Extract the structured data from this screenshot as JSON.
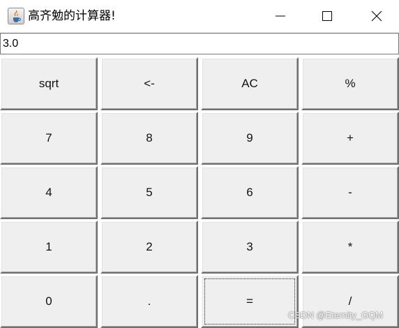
{
  "window": {
    "title": "高齐勉的计算器!",
    "icon": "java-cup-icon"
  },
  "display": {
    "value": "3.0"
  },
  "keys": [
    [
      "sqrt",
      "<-",
      "AC",
      "%"
    ],
    [
      "7",
      "8",
      "9",
      "+"
    ],
    [
      "4",
      "5",
      "6",
      "-"
    ],
    [
      "1",
      "2",
      "3",
      "*"
    ],
    [
      "0",
      ".",
      "=",
      "/"
    ]
  ],
  "focused_key": "=",
  "watermark": "CSDN @Eternity_GQM"
}
